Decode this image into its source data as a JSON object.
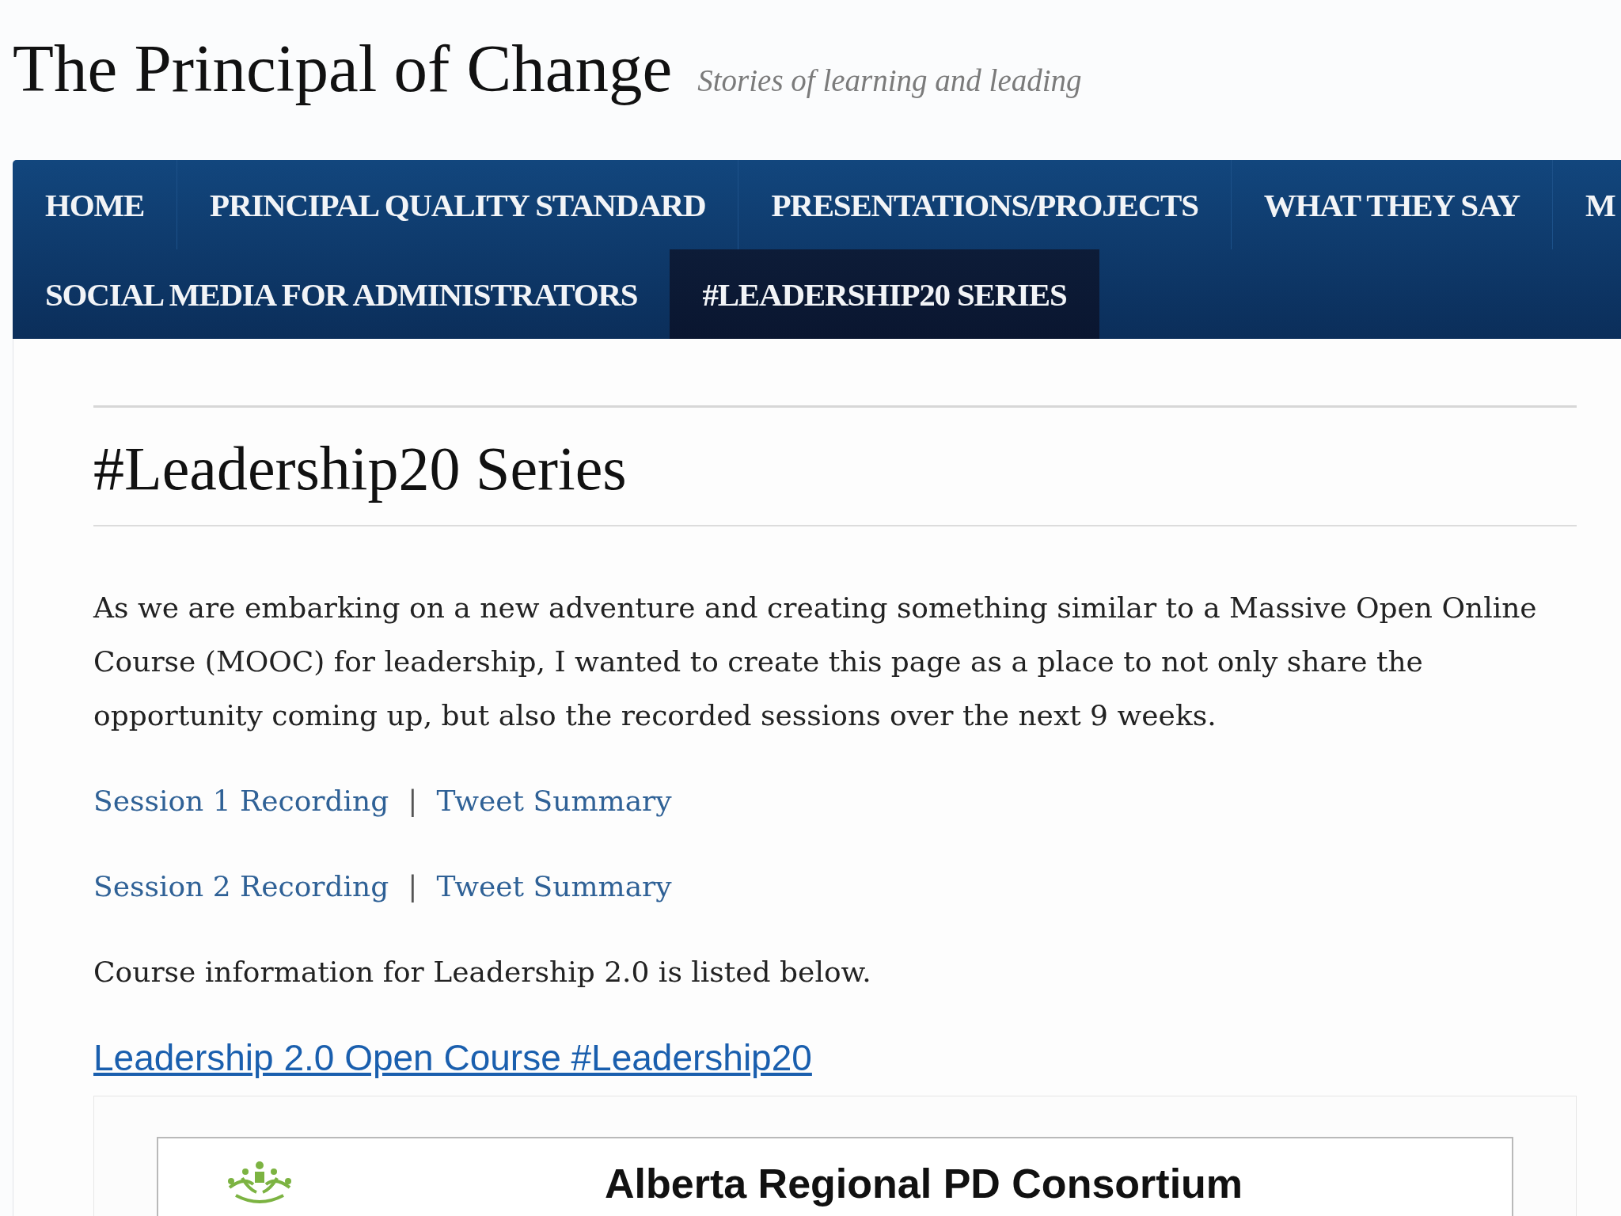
{
  "site": {
    "title": "The Principal of Change",
    "tagline": "Stories of learning and leading"
  },
  "nav_rows": [
    {
      "items": [
        {
          "label": "HOME",
          "selected": false
        },
        {
          "label": "PRINCIPAL QUALITY STANDARD",
          "selected": false
        },
        {
          "label": "PRESENTATIONS/PROJECTS",
          "selected": false
        },
        {
          "label": "WHAT THEY SAY",
          "selected": false
        },
        {
          "label": "M",
          "selected": false
        }
      ]
    },
    {
      "items": [
        {
          "label": "SOCIAL MEDIA FOR ADMINISTRATORS",
          "selected": false
        },
        {
          "label": "#LEADERSHIP20 SERIES",
          "selected": true
        }
      ]
    }
  ],
  "page": {
    "title": "#Leadership20 Series",
    "intro": "As we are embarking on a new adventure and creating something similar to a Massive Open Online Course (MOOC) for leadership, I wanted to create this page as a place to not only share the opportunity coming up, but also the recorded sessions over the next 9 weeks.",
    "session_links": [
      {
        "recording": "Session 1 Recording",
        "separator": "|",
        "summary": "Tweet Summary"
      },
      {
        "recording": "Session 2 Recording",
        "separator": "|",
        "summary": "Tweet Summary"
      }
    ],
    "course_note": "Course information for Leadership 2.0 is listed below.",
    "course_link": "Leadership 2.0 Open Course #Leadership20",
    "embed": {
      "title": "Alberta Regional PD Consortium"
    }
  }
}
